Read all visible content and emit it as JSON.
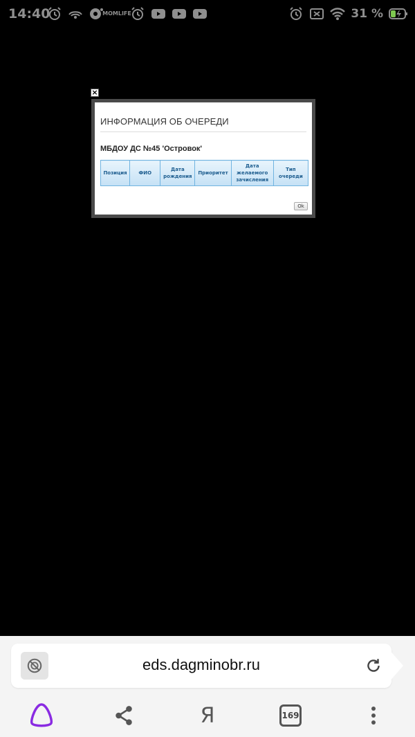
{
  "status_bar": {
    "time": "14:40",
    "left_icons": [
      "alarm-icon",
      "eye-wifi-icon",
      "record-icon",
      "mom-life-app-icon",
      "alarm-icon",
      "youtube-icon",
      "youtube-icon",
      "youtube-icon"
    ],
    "mom_life_label_top": "MOM",
    "mom_life_label_bottom": "LIFE",
    "right_icons": [
      "alarm-icon",
      "sim-blocked-icon",
      "wifi-icon"
    ],
    "battery_percent": "31 %",
    "battery_charging": true
  },
  "dialog": {
    "close_label": "×",
    "title": "ИНФОРМАЦИЯ ОБ ОЧЕРЕДИ",
    "subtitle": "МБДОУ ДС №45 'Островок'",
    "columns": [
      "Позиция",
      "ФИО",
      "Дата рождения",
      "Приоритет",
      "Дата желаемого зачисления",
      "Тип очереди"
    ],
    "rows": [],
    "ok_label": "Ok"
  },
  "browser": {
    "url": "eds.dagminobr.ru",
    "tabs_count": "169",
    "yandex_label": "Я",
    "accent_color": "#8a2be2"
  }
}
